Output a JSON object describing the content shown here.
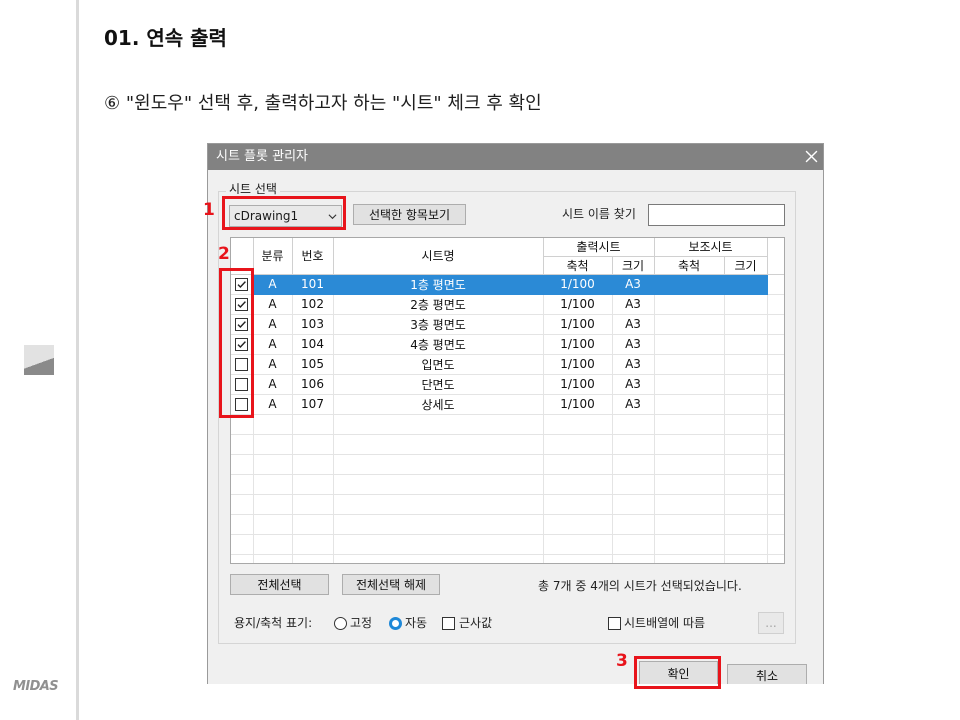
{
  "page": {
    "title": "01. 연속 출력",
    "step": "⑥ \"윈도우\" 선택 후, 출력하고자 하는 \"시트\" 체크 후 확인",
    "logo": "MIDAS"
  },
  "annotations": {
    "labels": [
      "1",
      "2",
      "3"
    ]
  },
  "icons": {
    "close": "close-icon",
    "dropdown": "chevron-down-icon",
    "check": "checkmark-icon",
    "thumbnail": "slide-thumbnail-icon"
  },
  "colors": {
    "selection": "#2b8ad6",
    "annotation": "#e8141b",
    "radio_selected": "#1e88d8",
    "titlebar": "#828282"
  },
  "dialog": {
    "title": "시트 플롯 관리자",
    "group_label": "시트 선택",
    "drawing_select": {
      "value": "cDrawing1"
    },
    "view_selected_button": "선택한 항목보기",
    "search_label": "시트 이름 찾기",
    "table": {
      "headers": {
        "category": "분류",
        "number": "번호",
        "sheet_name": "시트명",
        "output_sheet": "출력시트",
        "aux_sheet": "보조시트",
        "scale": "축척",
        "size": "크기"
      },
      "rows": [
        {
          "checked": true,
          "selected": true,
          "category": "A",
          "number": "101",
          "name": "1층 평면도",
          "output_scale": "1/100",
          "output_size": "A3",
          "aux_scale": "",
          "aux_size": ""
        },
        {
          "checked": true,
          "selected": false,
          "category": "A",
          "number": "102",
          "name": "2층 평면도",
          "output_scale": "1/100",
          "output_size": "A3",
          "aux_scale": "",
          "aux_size": ""
        },
        {
          "checked": true,
          "selected": false,
          "category": "A",
          "number": "103",
          "name": "3층 평면도",
          "output_scale": "1/100",
          "output_size": "A3",
          "aux_scale": "",
          "aux_size": ""
        },
        {
          "checked": true,
          "selected": false,
          "category": "A",
          "number": "104",
          "name": "4층 평면도",
          "output_scale": "1/100",
          "output_size": "A3",
          "aux_scale": "",
          "aux_size": ""
        },
        {
          "checked": false,
          "selected": false,
          "category": "A",
          "number": "105",
          "name": "입면도",
          "output_scale": "1/100",
          "output_size": "A3",
          "aux_scale": "",
          "aux_size": ""
        },
        {
          "checked": false,
          "selected": false,
          "category": "A",
          "number": "106",
          "name": "단면도",
          "output_scale": "1/100",
          "output_size": "A3",
          "aux_scale": "",
          "aux_size": ""
        },
        {
          "checked": false,
          "selected": false,
          "category": "A",
          "number": "107",
          "name": "상세도",
          "output_scale": "1/100",
          "output_size": "A3",
          "aux_scale": "",
          "aux_size": ""
        }
      ]
    },
    "select_all_button": "전체선택",
    "deselect_all_button": "전체선택 해제",
    "status": "총 7개 중 4개의 시트가 선택되었습니다.",
    "paper_scale_label": "용지/축척 표기:",
    "paper_scale_options": [
      {
        "label": "고정",
        "selected": false
      },
      {
        "label": "자동",
        "selected": true
      }
    ],
    "approx_checkbox": {
      "label": "근사값",
      "checked": false
    },
    "sheet_order_checkbox": {
      "label": "시트배열에 따름",
      "checked": false
    },
    "more_button": "...",
    "ok_button": "확인",
    "cancel_button": "취소"
  }
}
